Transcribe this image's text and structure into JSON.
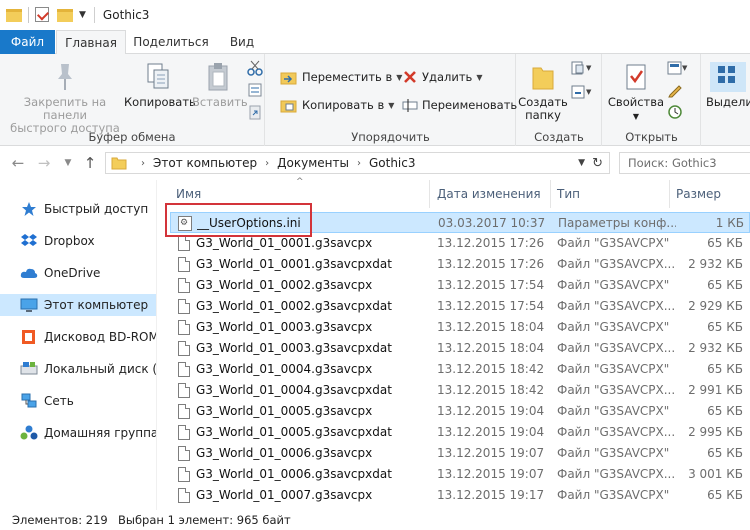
{
  "window": {
    "title": "Gothic3"
  },
  "ribbon_tabs": {
    "file": "Файл",
    "home": "Главная",
    "share": "Поделиться",
    "view": "Вид"
  },
  "clipboard": {
    "pin_line1": "Закрепить на панели",
    "pin_line2": "быстрого доступа",
    "copy": "Копировать",
    "paste": "Вставить",
    "label": "Буфер обмена"
  },
  "organize": {
    "move_to": "Переместить в",
    "copy_to": "Копировать в",
    "delete": "Удалить",
    "rename": "Переименовать",
    "label": "Упорядочить"
  },
  "create": {
    "new_folder_line1": "Создать",
    "new_folder_line2": "папку",
    "label": "Создать"
  },
  "open": {
    "properties": "Свойства",
    "label": "Открыть"
  },
  "select": {
    "select_label": "Выделить"
  },
  "address": {
    "crumbs": [
      "Этот компьютер",
      "Документы",
      "Gothic3"
    ],
    "search_placeholder": "Поиск: Gothic3"
  },
  "nav": {
    "items": [
      {
        "label": "Быстрый доступ",
        "icon": "star-icon"
      },
      {
        "label": "Dropbox",
        "icon": "dropbox-icon"
      },
      {
        "label": "OneDrive",
        "icon": "cloud-icon"
      },
      {
        "label": "Этот компьютер",
        "icon": "computer-icon"
      },
      {
        "label": "Дисковод BD-ROM (",
        "icon": "disc-drive-icon"
      },
      {
        "label": "Локальный диск (C:)",
        "icon": "hard-drive-icon"
      },
      {
        "label": "Сеть",
        "icon": "network-icon"
      },
      {
        "label": "Домашняя группа",
        "icon": "homegroup-icon"
      }
    ]
  },
  "columns": {
    "name": "Имя",
    "date": "Дата изменения",
    "type": "Тип",
    "size": "Размер"
  },
  "files": [
    {
      "name": "__UserOptions.ini",
      "date": "03.03.2017 10:37",
      "type": "Параметры конф...",
      "size": "1 КБ"
    },
    {
      "name": "G3_World_01_0001.g3savcpx",
      "date": "13.12.2015 17:26",
      "type": "Файл \"G3SAVCPX\"",
      "size": "65 КБ"
    },
    {
      "name": "G3_World_01_0001.g3savcpxdat",
      "date": "13.12.2015 17:26",
      "type": "Файл \"G3SAVCPX...",
      "size": "2 932 КБ"
    },
    {
      "name": "G3_World_01_0002.g3savcpx",
      "date": "13.12.2015 17:54",
      "type": "Файл \"G3SAVCPX\"",
      "size": "65 КБ"
    },
    {
      "name": "G3_World_01_0002.g3savcpxdat",
      "date": "13.12.2015 17:54",
      "type": "Файл \"G3SAVCPX...",
      "size": "2 929 КБ"
    },
    {
      "name": "G3_World_01_0003.g3savcpx",
      "date": "13.12.2015 18:04",
      "type": "Файл \"G3SAVCPX\"",
      "size": "65 КБ"
    },
    {
      "name": "G3_World_01_0003.g3savcpxdat",
      "date": "13.12.2015 18:04",
      "type": "Файл \"G3SAVCPX...",
      "size": "2 932 КБ"
    },
    {
      "name": "G3_World_01_0004.g3savcpx",
      "date": "13.12.2015 18:42",
      "type": "Файл \"G3SAVCPX\"",
      "size": "65 КБ"
    },
    {
      "name": "G3_World_01_0004.g3savcpxdat",
      "date": "13.12.2015 18:42",
      "type": "Файл \"G3SAVCPX...",
      "size": "2 991 КБ"
    },
    {
      "name": "G3_World_01_0005.g3savcpx",
      "date": "13.12.2015 19:04",
      "type": "Файл \"G3SAVCPX\"",
      "size": "65 КБ"
    },
    {
      "name": "G3_World_01_0005.g3savcpxdat",
      "date": "13.12.2015 19:04",
      "type": "Файл \"G3SAVCPX...",
      "size": "2 995 КБ"
    },
    {
      "name": "G3_World_01_0006.g3savcpx",
      "date": "13.12.2015 19:07",
      "type": "Файл \"G3SAVCPX\"",
      "size": "65 КБ"
    },
    {
      "name": "G3_World_01_0006.g3savcpxdat",
      "date": "13.12.2015 19:07",
      "type": "Файл \"G3SAVCPX...",
      "size": "3 001 КБ"
    },
    {
      "name": "G3_World_01_0007.g3savcpx",
      "date": "13.12.2015 19:17",
      "type": "Файл \"G3SAVCPX\"",
      "size": "65 КБ"
    }
  ],
  "status": {
    "count": "Элементов: 219",
    "selection": "Выбран 1 элемент: 965 байт"
  },
  "colors": {
    "file_tab": "#1979ca",
    "selected_bg": "#cce8ff",
    "selected_border": "#99d1ff",
    "highlight": "#d3343a"
  }
}
